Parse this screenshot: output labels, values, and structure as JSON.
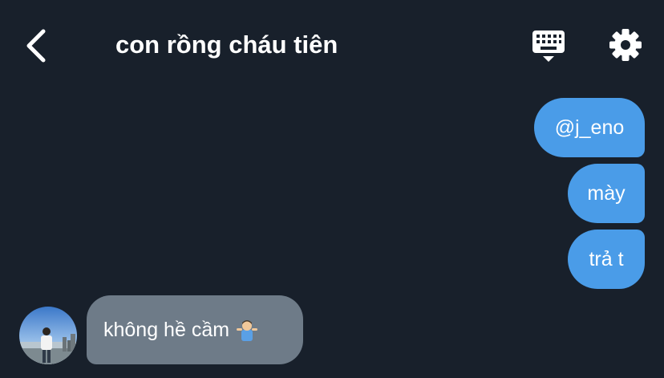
{
  "header": {
    "title": "con rồng cháu tiên",
    "back_icon": "chevron-left-icon",
    "keyboard_icon": "keyboard-icon",
    "settings_icon": "gear-icon"
  },
  "messages": {
    "outgoing": [
      {
        "text": "@j_eno"
      },
      {
        "text": "mày"
      },
      {
        "text": "trả t"
      }
    ],
    "incoming": [
      {
        "text": "không hề cầm",
        "emoji": "person-shrugging-emoji"
      }
    ]
  },
  "colors": {
    "background": "#18202b",
    "outgoing_bubble": "#4a9ce8",
    "incoming_bubble": "#6e7b88",
    "text": "#ffffff"
  }
}
